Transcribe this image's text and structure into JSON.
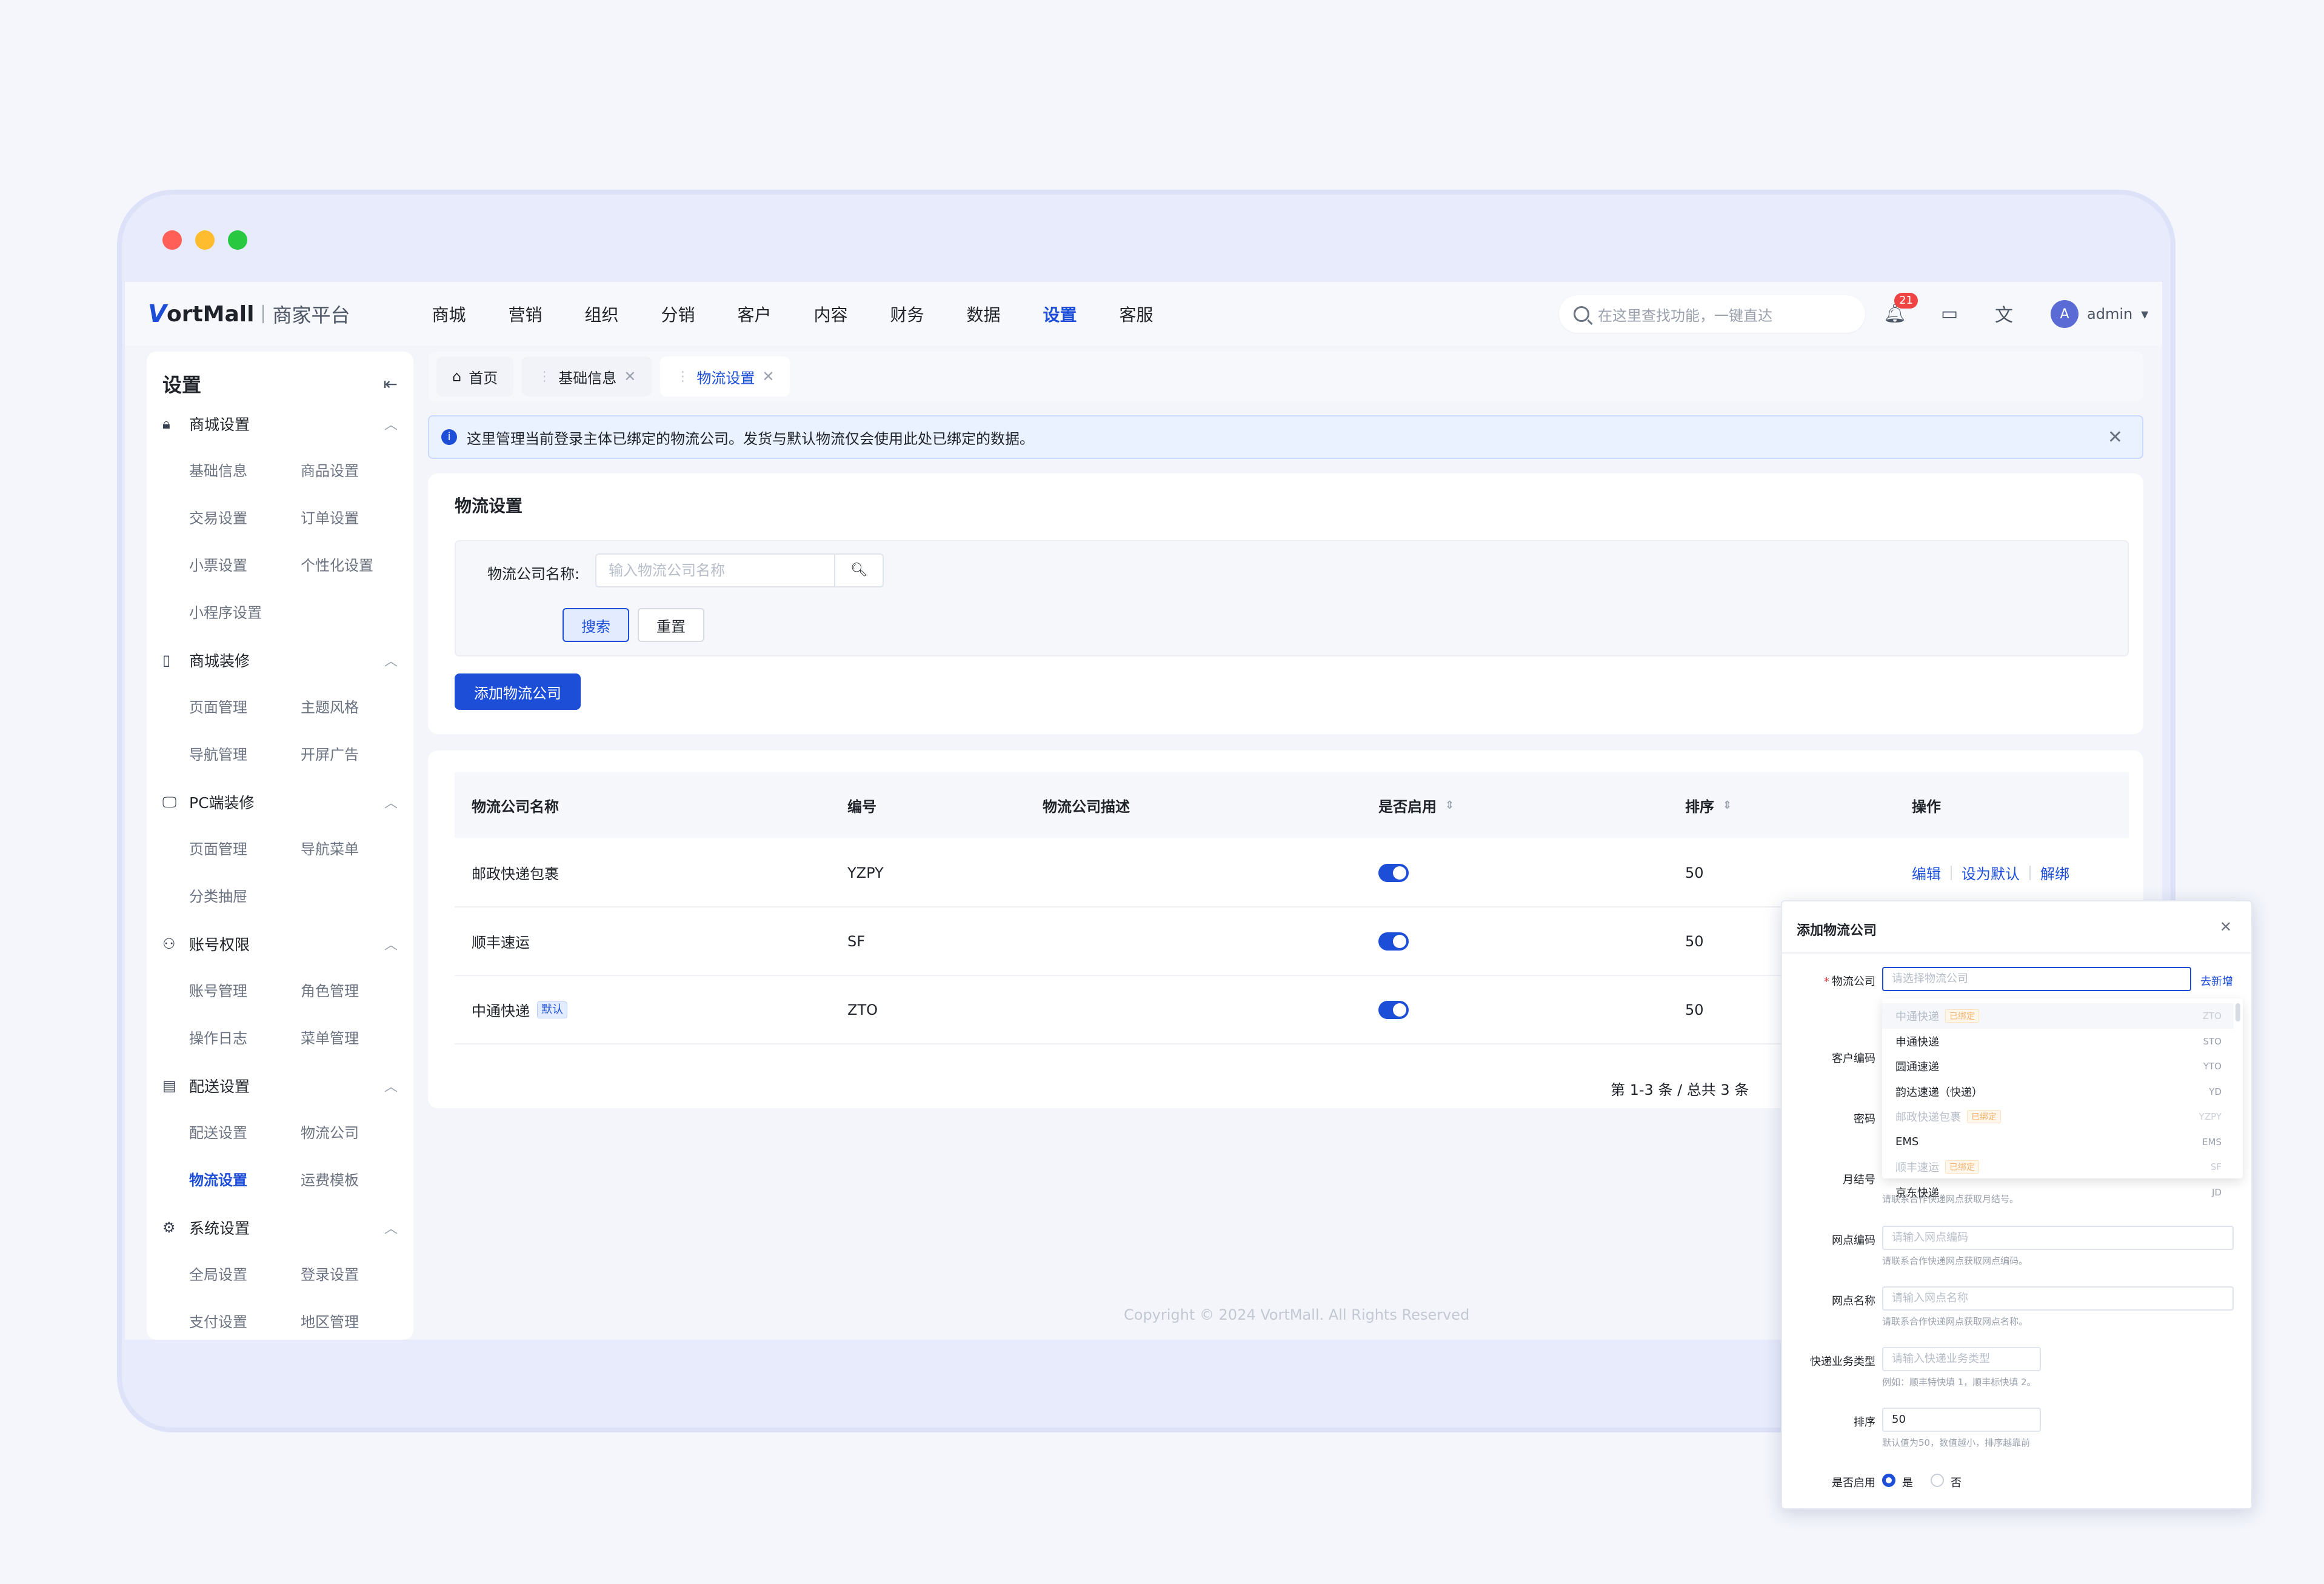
{
  "brand": {
    "logo_mark": "V",
    "logo_text": "ortMall",
    "sub": "商家平台"
  },
  "nav": [
    "商城",
    "营销",
    "组织",
    "分销",
    "客户",
    "内容",
    "财务",
    "数据",
    "设置",
    "客服"
  ],
  "nav_active": "设置",
  "search": {
    "placeholder": "在这里查找功能，一键直达"
  },
  "notifications": {
    "count": "21"
  },
  "user": {
    "name": "admin",
    "avatar_text": "A"
  },
  "sidebar": {
    "title": "设置",
    "groups": [
      {
        "label": "商城设置",
        "icon": "shop-lock-icon",
        "items": [
          "基础信息",
          "商品设置",
          "交易设置",
          "订单设置",
          "小票设置",
          "个性化设置",
          "小程序设置"
        ]
      },
      {
        "label": "商城装修",
        "icon": "tablet-icon",
        "items": [
          "页面管理",
          "主题风格",
          "导航管理",
          "开屏广告"
        ]
      },
      {
        "label": "PC端装修",
        "icon": "monitor-icon",
        "items": [
          "页面管理",
          "导航菜单",
          "分类抽屉"
        ]
      },
      {
        "label": "账号权限",
        "icon": "user-key-icon",
        "items": [
          "账号管理",
          "角色管理",
          "操作日志",
          "菜单管理"
        ]
      },
      {
        "label": "配送设置",
        "icon": "delivery-box-icon",
        "items": [
          "配送设置",
          "物流公司",
          "物流设置",
          "运费模板"
        ]
      },
      {
        "label": "系统设置",
        "icon": "gear-icon",
        "items": [
          "全局设置",
          "登录设置",
          "支付设置",
          "地区管理"
        ]
      }
    ],
    "active_item": "物流设置"
  },
  "tabs": [
    {
      "label": "首页"
    },
    {
      "label": "基础信息"
    },
    {
      "label": "物流设置"
    }
  ],
  "alert": {
    "text": "这里管理当前登录主体已绑定的物流公司。发货与默认物流仅会使用此处已绑定的数据。"
  },
  "filter_card": {
    "title": "物流设置",
    "name_label": "物流公司名称:",
    "name_placeholder": "输入物流公司名称",
    "search_btn": "搜索",
    "reset_btn": "重置",
    "add_btn": "添加物流公司"
  },
  "table": {
    "headers": [
      "物流公司名称",
      "编号",
      "物流公司描述",
      "是否启用",
      "排序",
      "操作"
    ],
    "rows": [
      {
        "name": "邮政快递包裹",
        "code": "YZPY",
        "desc": "",
        "enabled": true,
        "sort": "50",
        "default": false
      },
      {
        "name": "顺丰速运",
        "code": "SF",
        "desc": "",
        "enabled": true,
        "sort": "50",
        "default": false
      },
      {
        "name": "中通快递",
        "code": "ZTO",
        "desc": "",
        "enabled": true,
        "sort": "50",
        "default": true
      }
    ],
    "default_tag": "默认",
    "ops": [
      "编辑",
      "设为默认",
      "解绑"
    ],
    "pagination": "第 1-3 条 / 总共 3 条"
  },
  "footer": "Copyright © 2024 VortMall. All Rights Reserved",
  "modal": {
    "title": "添加物流公司",
    "company_label": "物流公司",
    "company_placeholder": "请选择物流公司",
    "add_new_link": "去新增",
    "bound_tag": "已绑定",
    "options": [
      {
        "name": "中通快递",
        "code": "ZTO",
        "bound": true
      },
      {
        "name": "申通快递",
        "code": "STO",
        "bound": false
      },
      {
        "name": "圆通速递",
        "code": "YTO",
        "bound": false
      },
      {
        "name": "韵达速递（快递）",
        "code": "YD",
        "bound": false
      },
      {
        "name": "邮政快递包裹",
        "code": "YZPY",
        "bound": true
      },
      {
        "name": "EMS",
        "code": "EMS",
        "bound": false
      },
      {
        "name": "顺丰速运",
        "code": "SF",
        "bound": true
      },
      {
        "name": "京东快递",
        "code": "JD",
        "bound": false
      }
    ],
    "customer_code_label": "客户编码",
    "password_label": "密码",
    "monthly_label": "月结号",
    "monthly_hint": "请联系合作快递网点获取月结号。",
    "branch_code_label": "网点编码",
    "branch_code_placeholder": "请输入网点编码",
    "branch_code_hint": "请联系合作快递网点获取网点编码。",
    "branch_name_label": "网点名称",
    "branch_name_placeholder": "请输入网点名称",
    "branch_name_hint": "请联系合作快递网点获取网点名称。",
    "biz_type_label": "快递业务类型",
    "biz_type_placeholder": "请输入快递业务类型",
    "biz_type_hint": "例如：顺丰特快填 1，顺丰标快填 2。",
    "sort_label": "排序",
    "sort_value": "50",
    "sort_hint": "默认值为50，数值越小，排序越靠前",
    "enabled_label": "是否启用",
    "enabled_yes": "是",
    "enabled_no": "否"
  }
}
